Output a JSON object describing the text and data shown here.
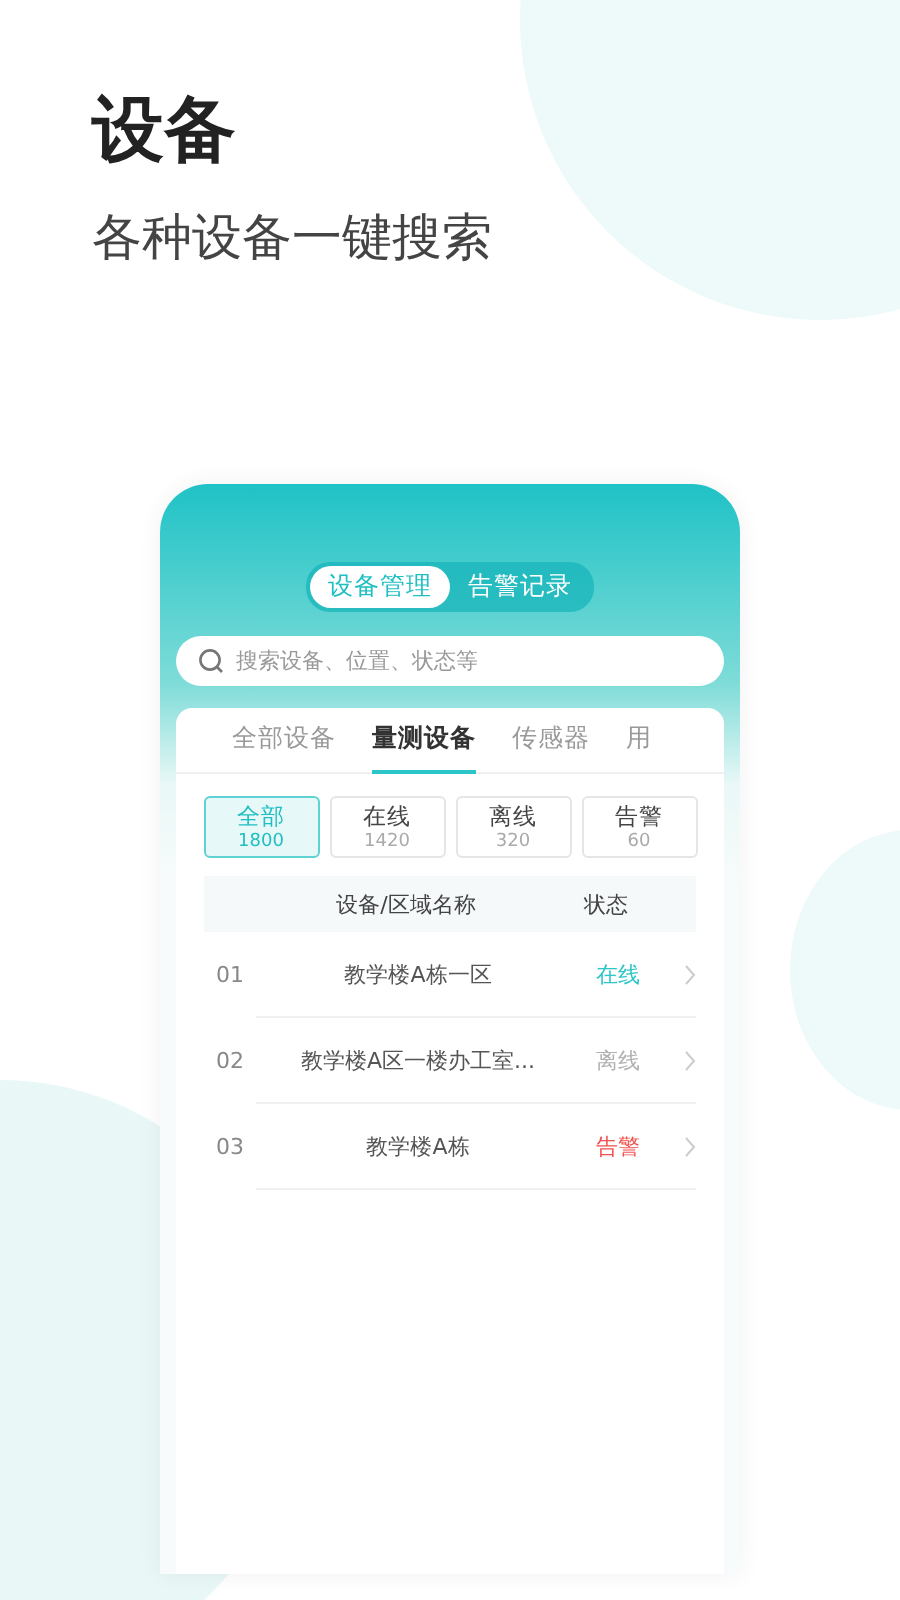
{
  "title": "设备",
  "subtitle": "各种设备一键搜索",
  "segments": [
    {
      "label": "设备管理",
      "selected": true
    },
    {
      "label": "告警记录",
      "selected": false
    }
  ],
  "search": {
    "placeholder": "搜索设备、位置、状态等"
  },
  "tabs": [
    {
      "label": "全部设备",
      "selected": false
    },
    {
      "label": "量测设备",
      "selected": true
    },
    {
      "label": "传感器",
      "selected": false
    },
    {
      "label": "用",
      "selected": false
    }
  ],
  "filters": [
    {
      "label": "全部",
      "count": "1800",
      "selected": true
    },
    {
      "label": "在线",
      "count": "1420",
      "selected": false
    },
    {
      "label": "离线",
      "count": "320",
      "selected": false
    },
    {
      "label": "告警",
      "count": "60",
      "selected": false
    }
  ],
  "table": {
    "columns": [
      "设备/区域名称",
      "状态"
    ],
    "rows": [
      {
        "index": "01",
        "name": "教学楼A栋一区",
        "status": "在线",
        "color": "#2cc5c8"
      },
      {
        "index": "02",
        "name": "教学楼A区一楼办工室...",
        "status": "离线",
        "color": "#b0b0b0"
      },
      {
        "index": "03",
        "name": "教学楼A栋",
        "status": "告警",
        "color": "#f0524f"
      }
    ]
  }
}
